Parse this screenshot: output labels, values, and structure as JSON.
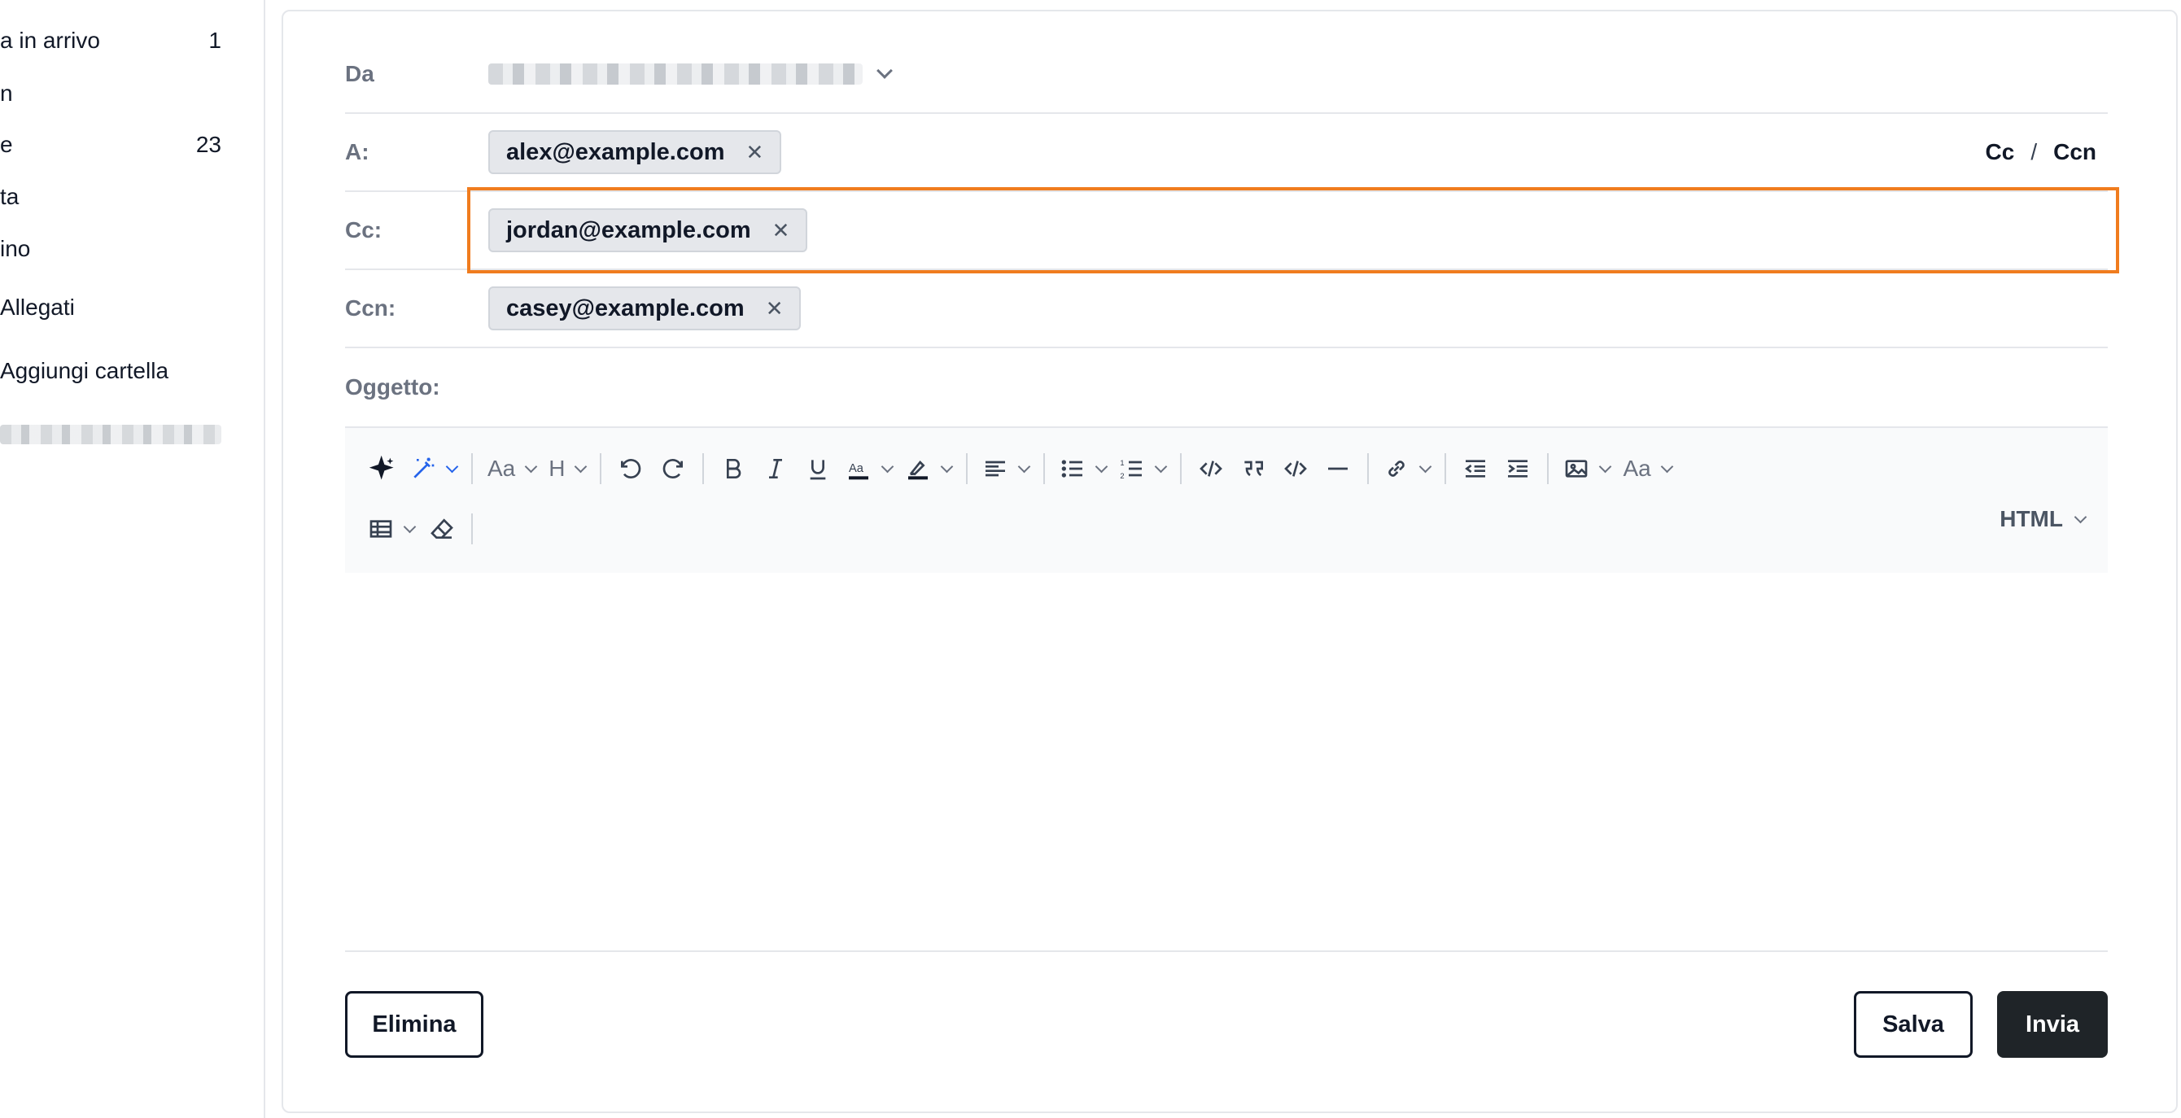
{
  "sidebar": {
    "items": [
      {
        "label": "a in arrivo",
        "count": "1"
      },
      {
        "label": "n",
        "count": ""
      },
      {
        "label": "e",
        "count": "23"
      },
      {
        "label": "ta",
        "count": ""
      },
      {
        "label": "ino",
        "count": ""
      },
      {
        "label": "Allegati",
        "count": ""
      },
      {
        "label": "Aggiungi cartella",
        "count": ""
      }
    ]
  },
  "compose": {
    "from_label": "Da",
    "to_label": "A:",
    "to_chips": [
      "alex@example.com"
    ],
    "cc_label": "Cc:",
    "cc_chips": [
      "jordan@example.com"
    ],
    "bcc_label": "Ccn:",
    "bcc_chips": [
      "casey@example.com"
    ],
    "cc_link": "Cc",
    "cc_sep": "/",
    "bcc_link": "Ccn",
    "subject_label": "Oggetto:",
    "subject_value": ""
  },
  "toolbar": {
    "font_size_label": "Aa",
    "heading_label": "H",
    "format_label": "Aa",
    "mode_label": "HTML",
    "accent_color": "#2563eb"
  },
  "footer": {
    "delete_label": "Elimina",
    "save_label": "Salva",
    "send_label": "Invia"
  },
  "colors": {
    "focus_outline": "#f07c1e",
    "send_button": "#1f2428"
  }
}
